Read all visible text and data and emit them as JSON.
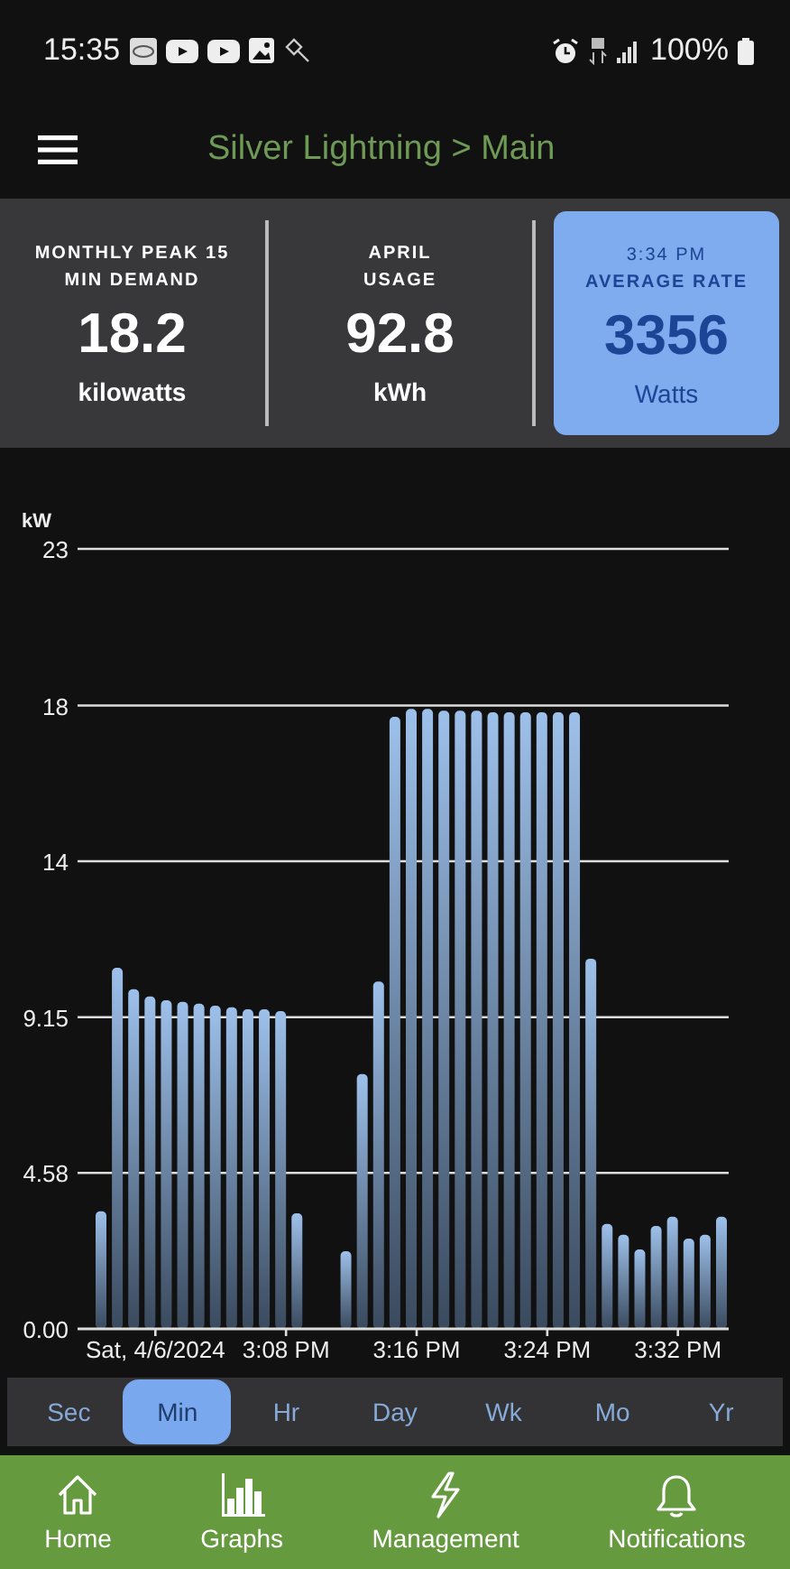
{
  "status_bar": {
    "time": "15:35",
    "battery": "100%"
  },
  "header": {
    "title": "Silver Lightning > Main"
  },
  "stats": [
    {
      "label_lines": [
        "MONTHLY PEAK 15",
        "MIN DEMAND"
      ],
      "value": "18.2",
      "unit": "kilowatts",
      "highlighted": false
    },
    {
      "label_lines": [
        "APRIL",
        "USAGE"
      ],
      "value": "92.8",
      "unit": "kWh",
      "highlighted": false
    },
    {
      "time": "3:34 PM",
      "label_lines": [
        "AVERAGE RATE"
      ],
      "value": "3356",
      "unit": "Watts",
      "highlighted": true
    }
  ],
  "chart": {
    "chart_data": {
      "type": "bar",
      "ylabel": "kW",
      "categories": [
        null,
        null,
        null,
        "Sat, 4/6/2024",
        null,
        null,
        null,
        null,
        null,
        null,
        null,
        "3:08 PM",
        null,
        null,
        null,
        null,
        null,
        null,
        null,
        "3:16 PM",
        null,
        null,
        null,
        null,
        null,
        null,
        null,
        "3:24 PM",
        null,
        null,
        null,
        null,
        null,
        null,
        null,
        "3:32 PM",
        null,
        null,
        null
      ],
      "grid": true,
      "series": [
        {
          "color": "#9dc0ea",
          "values": [
            3.45,
            10.6,
            9.97,
            9.76,
            9.65,
            9.6,
            9.55,
            9.49,
            9.44,
            9.38,
            9.38,
            9.33,
            3.39,
            null,
            null,
            2.28,
            7.48,
            10.2,
            17.97,
            18.2,
            18.2,
            18.15,
            18.15,
            18.15,
            18.1,
            18.1,
            18.1,
            18.1,
            18.1,
            18.1,
            10.87,
            3.08,
            2.76,
            2.33,
            3.02,
            3.29,
            2.65,
            2.76,
            3.29
          ]
        }
      ],
      "ylim": [
        0,
        22.9
      ],
      "yticks": [
        {
          "value": 0,
          "label": "0.00"
        },
        {
          "value": 4.58,
          "label": "4.58"
        },
        {
          "value": 9.15,
          "label": "9.15"
        },
        {
          "value": 13.73,
          "label": "14"
        },
        {
          "value": 18.3,
          "label": "18"
        },
        {
          "value": 22.9,
          "label": "23"
        }
      ]
    }
  },
  "ranges": [
    {
      "label": "Sec",
      "selected": false
    },
    {
      "label": "Min",
      "selected": true
    },
    {
      "label": "Hr",
      "selected": false
    },
    {
      "label": "Day",
      "selected": false
    },
    {
      "label": "Wk",
      "selected": false
    },
    {
      "label": "Mo",
      "selected": false
    },
    {
      "label": "Yr",
      "selected": false
    }
  ],
  "nav": [
    {
      "label": "Home"
    },
    {
      "label": "Graphs"
    },
    {
      "label": "Management"
    },
    {
      "label": "Notifications"
    }
  ]
}
